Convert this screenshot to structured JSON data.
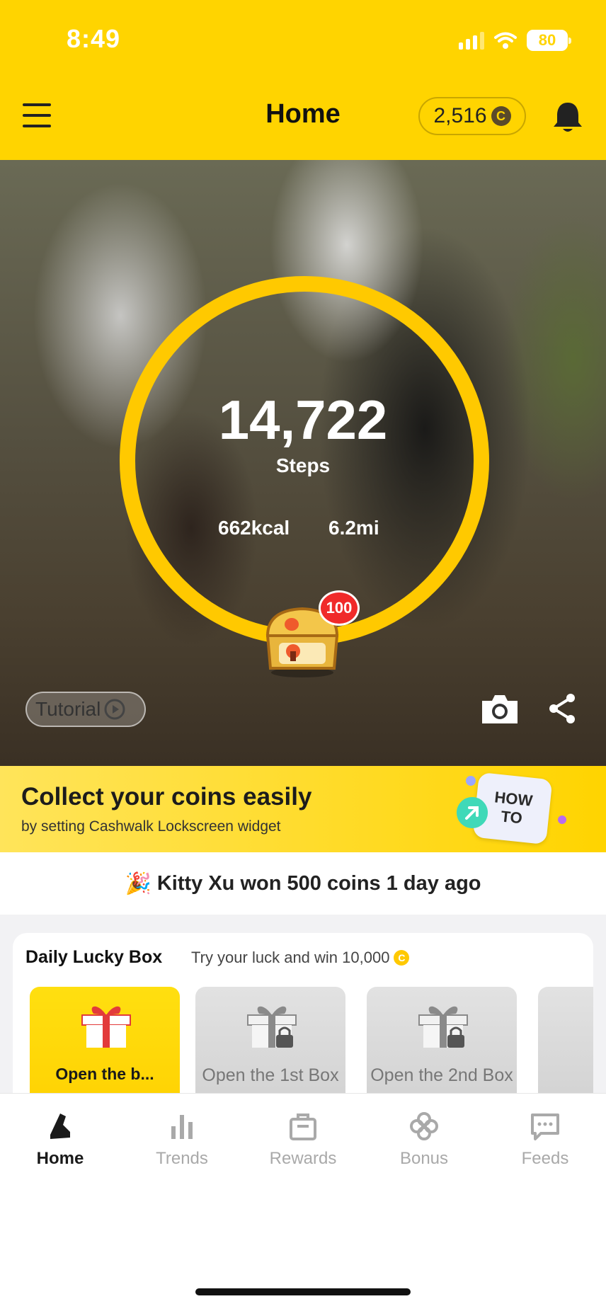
{
  "status_bar": {
    "time": "8:49",
    "battery": "80"
  },
  "header": {
    "title": "Home",
    "coins": "2,516",
    "coin_symbol": "C"
  },
  "tracker": {
    "steps": "14,722",
    "steps_label": "Steps",
    "calories": "662kcal",
    "distance": "6.2mi",
    "chest_badge": "100",
    "tutorial_label": "Tutorial",
    "ring_color": "#ffc900"
  },
  "banner": {
    "title": "Collect your coins easily",
    "subtitle": "by setting Cashwalk Lockscreen widget",
    "howto_label": "HOW TO"
  },
  "winner_ticker": {
    "emoji": "🎉",
    "text": "Kitty Xu won 500 coins 1 day ago"
  },
  "lucky_box": {
    "title": "Daily Lucky Box",
    "subtitle": "Try your luck and win 10,000",
    "coin_symbol": "C",
    "boxes": [
      {
        "label": "Open the b..."
      },
      {
        "label": "Open the 1st Box"
      },
      {
        "label": "Open the 2nd Box"
      }
    ]
  },
  "tab_bar": {
    "items": [
      {
        "label": "Home",
        "icon": "sneaker-icon"
      },
      {
        "label": "Trends",
        "icon": "bar-chart-icon"
      },
      {
        "label": "Rewards",
        "icon": "shopping-bag-icon"
      },
      {
        "label": "Bonus",
        "icon": "clover-icon"
      },
      {
        "label": "Feeds",
        "icon": "chat-bubble-icon"
      }
    ]
  },
  "colors": {
    "brand_yellow": "#ffd400",
    "badge_red": "#f02a2a"
  }
}
